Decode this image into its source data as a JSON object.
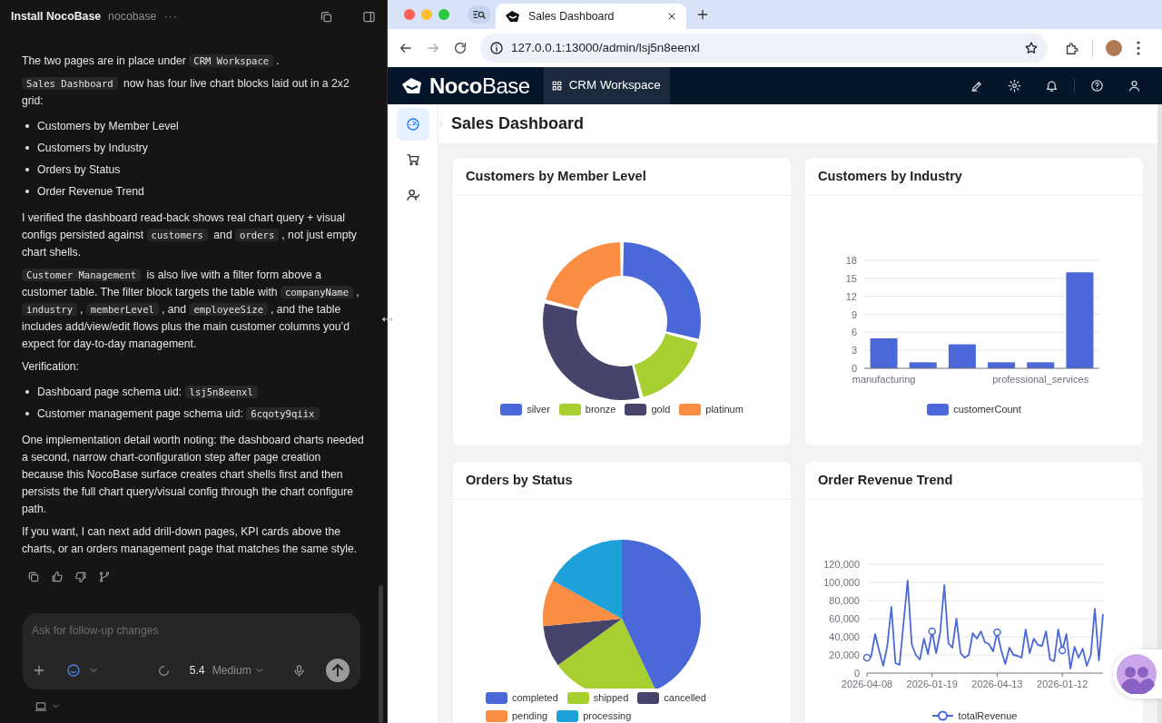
{
  "chat": {
    "title": "Install NocoBase",
    "project": "nocobase",
    "more": "···",
    "blocks": [
      {
        "kind": "paragraph",
        "parts": [
          {
            "kind": "text",
            "text": "The two pages are in place under "
          },
          {
            "kind": "code",
            "text": "CRM Workspace"
          },
          {
            "kind": "text",
            "text": "."
          }
        ]
      },
      {
        "kind": "paragraph",
        "parts": [
          {
            "kind": "code",
            "text": "Sales Dashboard"
          },
          {
            "kind": "text",
            "text": " now has four live chart blocks laid out in a 2x2 grid:"
          }
        ]
      },
      {
        "kind": "bullets",
        "items": [
          {
            "parts": [
              {
                "kind": "text",
                "text": "Customers by Member Level"
              }
            ]
          },
          {
            "parts": [
              {
                "kind": "text",
                "text": "Customers by Industry"
              }
            ]
          },
          {
            "parts": [
              {
                "kind": "text",
                "text": "Orders by Status"
              }
            ]
          },
          {
            "parts": [
              {
                "kind": "text",
                "text": "Order Revenue Trend"
              }
            ]
          }
        ]
      },
      {
        "kind": "paragraph",
        "parts": [
          {
            "kind": "text",
            "text": "I verified the dashboard read-back shows real chart query + visual configs persisted against "
          },
          {
            "kind": "code",
            "text": "customers"
          },
          {
            "kind": "text",
            "text": " and "
          },
          {
            "kind": "code",
            "text": "orders"
          },
          {
            "kind": "text",
            "text": ", not just empty chart shells."
          }
        ]
      },
      {
        "kind": "paragraph",
        "parts": [
          {
            "kind": "code",
            "text": "Customer Management"
          },
          {
            "kind": "text",
            "text": " is also live with a filter form above a customer table. The filter block targets the table with "
          },
          {
            "kind": "code",
            "text": "companyName"
          },
          {
            "kind": "text",
            "text": ", "
          },
          {
            "kind": "code",
            "text": "industry"
          },
          {
            "kind": "text",
            "text": ", "
          },
          {
            "kind": "code",
            "text": "memberLevel"
          },
          {
            "kind": "text",
            "text": ", and "
          },
          {
            "kind": "code",
            "text": "employeeSize"
          },
          {
            "kind": "text",
            "text": ", and the table includes add/view/edit flows plus the main customer columns you’d expect for day-to-day management."
          }
        ]
      },
      {
        "kind": "paragraph",
        "parts": [
          {
            "kind": "text",
            "text": "Verification:"
          }
        ]
      },
      {
        "kind": "bullets",
        "items": [
          {
            "parts": [
              {
                "kind": "text",
                "text": "Dashboard page schema uid: "
              },
              {
                "kind": "code",
                "text": "lsj5n8eenxl"
              }
            ]
          },
          {
            "parts": [
              {
                "kind": "text",
                "text": "Customer management page schema uid: "
              },
              {
                "kind": "code",
                "text": "6cqoty9qiix"
              }
            ]
          }
        ]
      },
      {
        "kind": "paragraph",
        "parts": [
          {
            "kind": "text",
            "text": "One implementation detail worth noting: the dashboard charts needed a second, narrow chart-configuration step after page creation because this NocoBase surface creates chart shells first and then persists the full chart query/visual config through the chart configure path."
          }
        ]
      },
      {
        "kind": "paragraph",
        "parts": [
          {
            "kind": "text",
            "text": "If you want, I can next add drill-down pages, KPI cards above the charts, or an orders management page that matches the same style."
          }
        ]
      }
    ],
    "composer": {
      "placeholder": "Ask for follow-up changes",
      "model": "5.4",
      "effort": "Medium"
    }
  },
  "browser": {
    "tabs": [
      {
        "title": "Sales Dashboard",
        "selected": true
      }
    ],
    "url": "127.0.0.1:13000/admin/lsj5n8eenxl"
  },
  "app": {
    "logo": "**Noco**Base",
    "top_menu": [
      {
        "label": "CRM Workspace",
        "selected": true
      }
    ],
    "side_menu": [
      {
        "selected": true
      },
      {
        "selected": false
      },
      {
        "selected": false
      }
    ],
    "page_title": "Sales Dashboard",
    "cards": [
      {
        "title": "Customers by Member Level",
        "kind": "donut",
        "legend": [
          {
            "label": "silver",
            "color": "#4a68d8"
          },
          {
            "label": "bronze",
            "color": "#a6cf2f"
          },
          {
            "label": "gold",
            "color": "#46446a"
          },
          {
            "label": "platinum",
            "color": "#f98e43"
          }
        ]
      },
      {
        "title": "Customers by Industry",
        "chart_data": {
          "type": "bar",
          "grid": true,
          "categories": [
            "manufacturing",
            null,
            null,
            null,
            "professional_services",
            null
          ],
          "series": [
            {
              "name": "customerCount",
              "color": "#4a68d8",
              "values": [
                5,
                1,
                4,
                1,
                1,
                16
              ]
            }
          ],
          "ylim": [
            0,
            18
          ],
          "yticks": [
            0,
            3,
            6,
            9,
            12,
            15,
            18
          ]
        }
      },
      {
        "title": "Orders by Status",
        "kind": "pie",
        "legend": [
          {
            "label": "completed",
            "color": "#4a68d8"
          },
          {
            "label": "shipped",
            "color": "#a6cf2f"
          },
          {
            "label": "cancelled",
            "color": "#46446a"
          },
          {
            "label": "pending",
            "color": "#f98e43"
          },
          {
            "label": "processing",
            "color": "#1ea0d8"
          }
        ]
      },
      {
        "title": "Order Revenue Trend",
        "chart_data": {
          "type": "line",
          "grid": true,
          "categories": [
            "2026-04-08",
            null,
            null,
            null,
            null,
            null,
            null,
            null,
            null,
            null,
            null,
            null,
            null,
            null,
            null,
            null,
            "2026-01-19",
            null,
            null,
            null,
            null,
            null,
            null,
            null,
            null,
            null,
            null,
            null,
            null,
            null,
            null,
            null,
            "2026-04-13",
            null,
            null,
            null,
            null,
            null,
            null,
            null,
            null,
            null,
            null,
            null,
            null,
            null,
            null,
            null,
            "2026-01-12",
            null,
            null,
            null,
            null,
            null,
            null,
            null,
            null,
            null,
            null
          ],
          "series": [
            {
              "name": "totalRevenue",
              "color": "#4a68d8",
              "values": [
                17000,
                18000,
                43000,
                25000,
                8000,
                30000,
                73000,
                11000,
                9000,
                55000,
                102000,
                32000,
                20000,
                15000,
                38000,
                21000,
                46000,
                22000,
                45000,
                97000,
                33000,
                28000,
                60000,
                22000,
                17000,
                20000,
                44000,
                38000,
                46000,
                34000,
                32000,
                24000,
                45000,
                25000,
                10000,
                28000,
                20000,
                19000,
                17000,
                48000,
                22000,
                38000,
                31000,
                30000,
                46000,
                15000,
                13000,
                48000,
                25000,
                43000,
                5000,
                29000,
                17000,
                27000,
                8000,
                20000,
                71000,
                14000,
                65000
              ]
            }
          ],
          "ylim": [
            0,
            120000
          ],
          "yticks": [
            {
              "value": 0,
              "label": "0"
            },
            {
              "value": 20000,
              "label": "20,000"
            },
            {
              "value": 40000,
              "label": "40,000"
            },
            {
              "value": 60000,
              "label": "60,000"
            },
            {
              "value": 80000,
              "label": "80,000"
            },
            {
              "value": 100000,
              "label": "100,000"
            },
            {
              "value": 120000,
              "label": "120,000"
            }
          ]
        }
      }
    ]
  }
}
